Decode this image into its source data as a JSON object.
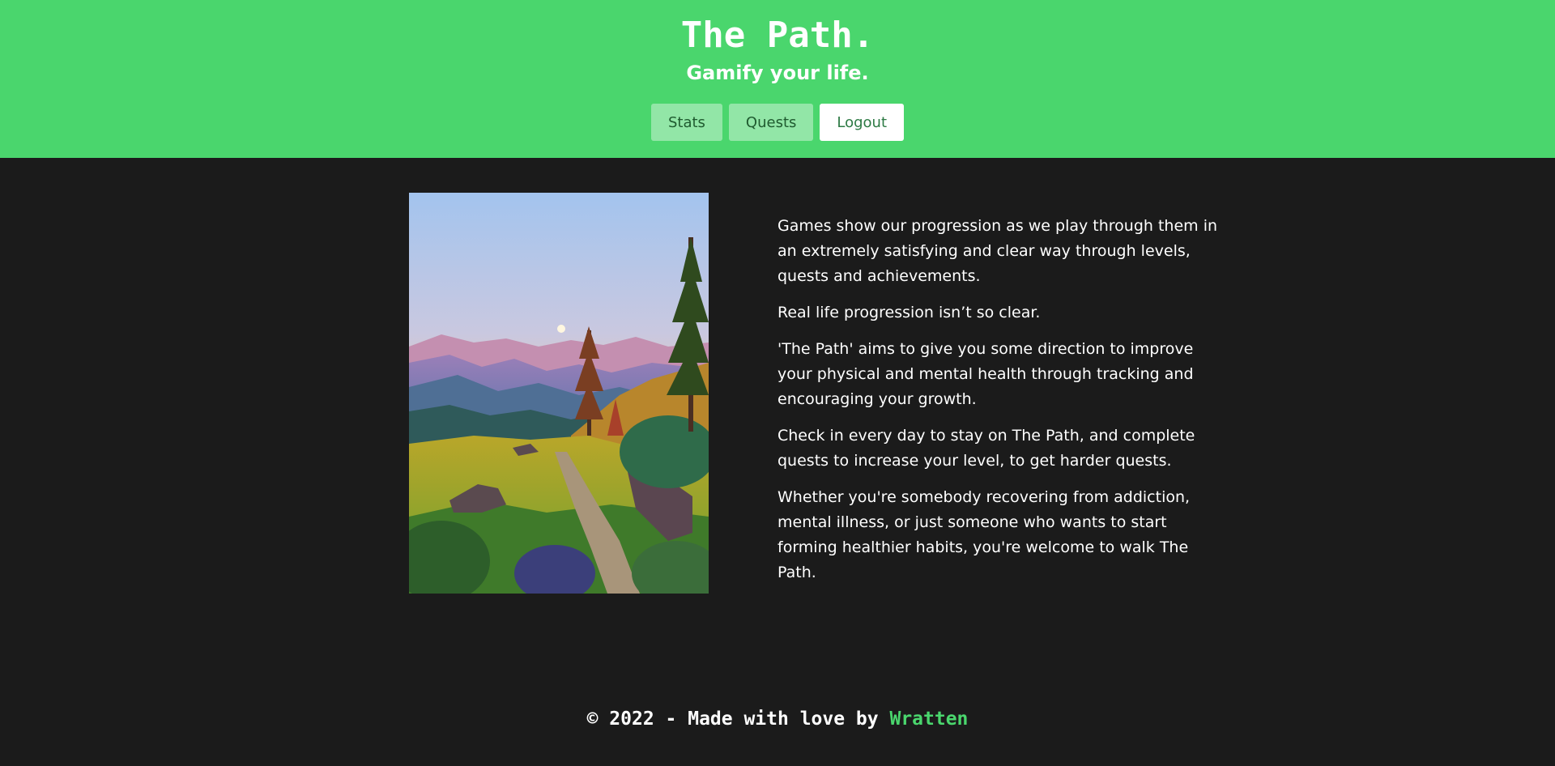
{
  "header": {
    "title": "The Path.",
    "subtitle": "Gamify your life."
  },
  "nav": {
    "items": [
      {
        "label": "Stats"
      },
      {
        "label": "Quests"
      },
      {
        "label": "Logout"
      }
    ]
  },
  "hero": {
    "image_subject": "pixel-art mountain path landscape"
  },
  "content": {
    "paragraphs": [
      "Games show our progression as we play through them in an extremely satisfying and clear way through levels, quests and achievements.",
      "Real life progression isn’t so clear.",
      "'The Path' aims to give you some direction to improve your physical and mental health through tracking and encouraging your growth.",
      "Check in every day to stay on The Path, and complete quests to increase your level, to get harder quests.",
      "Whether you're somebody recovering from addiction, mental illness, or just someone who wants to start forming healthier habits, you're welcome to walk The Path."
    ]
  },
  "footer": {
    "text": "© 2022 - Made with love by ",
    "author": "Wratten"
  },
  "colors": {
    "brand_green": "#4ad66d",
    "light_green": "#92e6a7",
    "background": "#1b1b1b"
  }
}
